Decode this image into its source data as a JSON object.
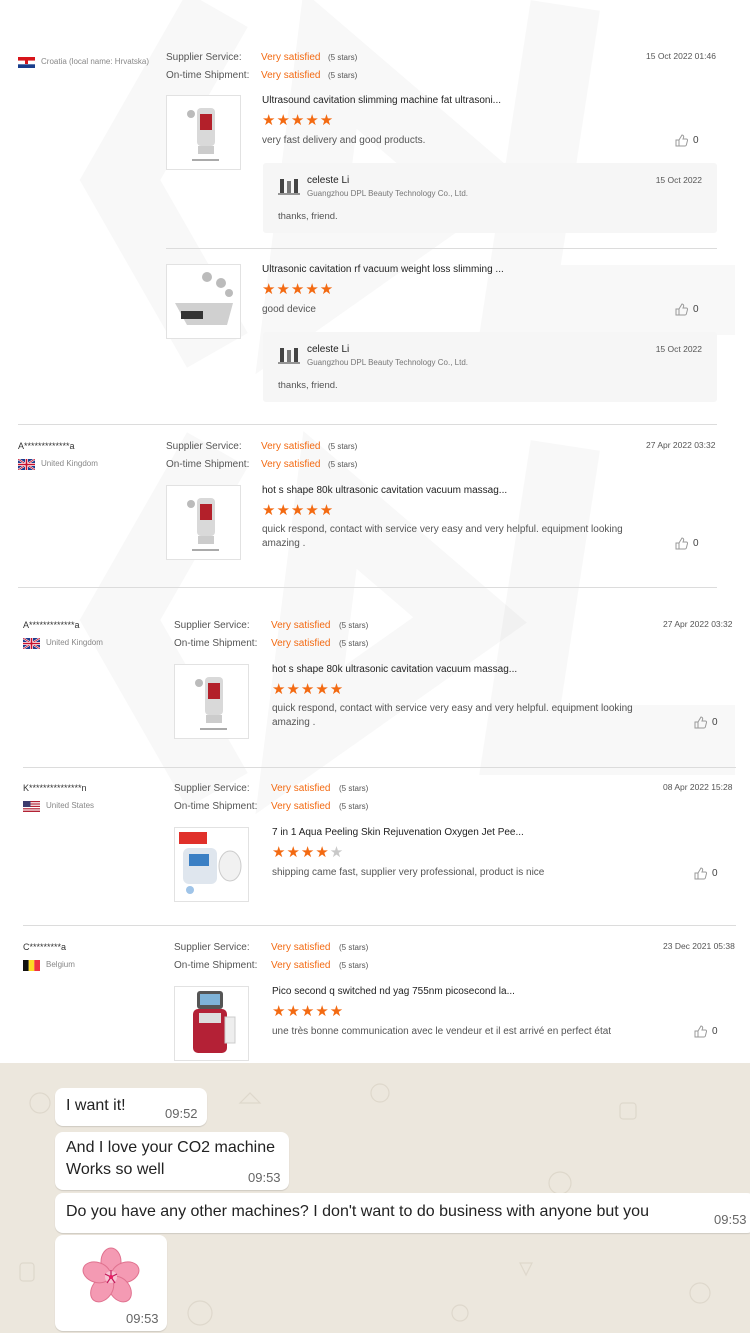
{
  "stars_label": "(5 stars)",
  "labels": {
    "supplier": "Supplier Service:",
    "shipment": "On-time Shipment:"
  },
  "colors": {
    "accent": "#f36a12",
    "star_off": "#c8c8c8",
    "chat_bg": "#ece7dd"
  },
  "reviews": [
    {
      "name": "",
      "country": "Croatia (local name: Hrvatska)",
      "flag_icon": "croatia-flag-icon",
      "supplier_value": "Very satisfied",
      "shipment_value": "Very satisfied",
      "date": "15 Oct 2022 01:46",
      "products": [
        {
          "title": "Ultrasound cavitation slimming machine fat ultrasoni...",
          "rating": 5,
          "comment": "very fast delivery and good products.",
          "likes": "0",
          "reply": {
            "name": "celeste Li",
            "company": "Guangzhou DPL Beauty Technology Co., Ltd.",
            "date": "15 Oct 2022",
            "text": "thanks, friend."
          }
        },
        {
          "title": "Ultrasonic cavitation rf vacuum weight loss slimming ...",
          "rating": 5,
          "comment": "good device",
          "likes": "0",
          "reply": {
            "name": "celeste Li",
            "company": "Guangzhou DPL Beauty Technology Co., Ltd.",
            "date": "15 Oct 2022",
            "text": "thanks, friend."
          }
        }
      ]
    },
    {
      "name": "A*************a",
      "country": "United Kingdom",
      "flag_icon": "uk-flag-icon",
      "supplier_value": "Very satisfied",
      "shipment_value": "Very satisfied",
      "date": "27 Apr 2022 03:32",
      "products": [
        {
          "title": "hot s shape 80k ultrasonic cavitation vacuum massag...",
          "rating": 5,
          "comment": "quick respond, contact with service very easy and very helpful. equipment looking amazing .",
          "likes": "0"
        }
      ]
    },
    {
      "name": "A*************a",
      "country": "United Kingdom",
      "flag_icon": "uk-flag-icon",
      "supplier_value": "Very satisfied",
      "shipment_value": "Very satisfied",
      "date": "27 Apr 2022 03:32",
      "products": [
        {
          "title": "hot s shape 80k ultrasonic cavitation vacuum massag...",
          "rating": 5,
          "comment": "quick respond, contact with service very easy and very helpful. equipment looking amazing .",
          "likes": "0"
        }
      ]
    },
    {
      "name": "K***************n",
      "country": "United States",
      "flag_icon": "us-flag-icon",
      "supplier_value": "Very satisfied",
      "shipment_value": "Very satisfied",
      "date": "08 Apr 2022 15:28",
      "products": [
        {
          "title": "7 in 1 Aqua Peeling Skin Rejuvenation Oxygen Jet Pee...",
          "rating": 4,
          "comment": "shipping came fast, supplier very professional, product is nice",
          "likes": "0"
        }
      ]
    },
    {
      "name": "C*********a",
      "country": "Belgium",
      "flag_icon": "belgium-flag-icon",
      "supplier_value": "Very satisfied",
      "shipment_value": "Very satisfied",
      "date": "23 Dec 2021 05:38",
      "products": [
        {
          "title": "Pico second q switched nd yag 755nm picosecond la...",
          "rating": 5,
          "comment": "une très bonne communication avec le vendeur et il est arrivé en perfect état",
          "likes": "0"
        }
      ]
    }
  ],
  "chat": {
    "messages": [
      {
        "lines": [
          "I want it!"
        ],
        "time": "09:52"
      },
      {
        "lines": [
          "And I love your CO2 machine",
          "Works so well"
        ],
        "time": "09:53"
      },
      {
        "lines": [
          "Do you have any other machines? I don't want to do business with anyone but you"
        ],
        "time": "09:53"
      },
      {
        "sticker": "cherry-blossom-sticker",
        "time": "09:53"
      }
    ]
  }
}
